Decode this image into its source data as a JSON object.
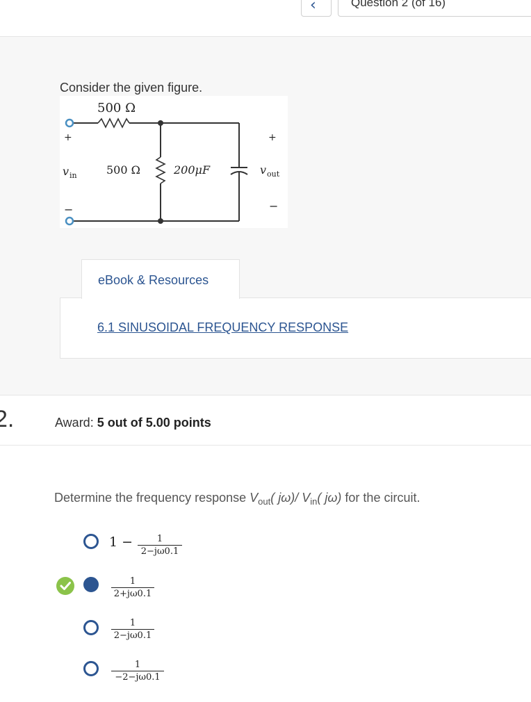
{
  "nav": {
    "prev_symbol": "‹",
    "question_selector": "Question 2 (of 16)"
  },
  "question1": {
    "intro": "Consider the given figure.",
    "figure": {
      "r1": "500 Ω",
      "r2": "500 Ω",
      "c": "200μF",
      "vin_main": "v",
      "vin_sub": "in",
      "vout_main": "v",
      "vout_sub": "out",
      "plus": "+",
      "minus": "−"
    },
    "resources_tab": "eBook & Resources",
    "resource_link": "6.1 SINUSOIDAL FREQUENCY RESPONSE"
  },
  "question2": {
    "number": "2.",
    "award_label": "Award:",
    "award_value": "5 out of 5.00 points",
    "prompt": {
      "before": "Determine the frequency response ",
      "v1": "V",
      "v1_sub": "out",
      "arg1": "( jω)/ ",
      "v2": "V",
      "v2_sub": "in",
      "arg2": "( jω)",
      "after": " for the circuit."
    },
    "options": [
      {
        "prefix": "1 −",
        "numerator": "1",
        "denominator": "2−jω0.1",
        "selected": false,
        "correct": false
      },
      {
        "prefix": "",
        "numerator": "1",
        "denominator": "2+jω0.1",
        "selected": true,
        "correct": true
      },
      {
        "prefix": "",
        "numerator": "1",
        "denominator": "2−jω0.1",
        "selected": false,
        "correct": false
      },
      {
        "prefix": "",
        "numerator": "1",
        "denominator": "−2−jω0.1",
        "selected": false,
        "correct": false
      }
    ]
  },
  "colors": {
    "accent": "#2c5591",
    "correct": "#8bc34a",
    "panel_bg": "#f7f7f7"
  }
}
